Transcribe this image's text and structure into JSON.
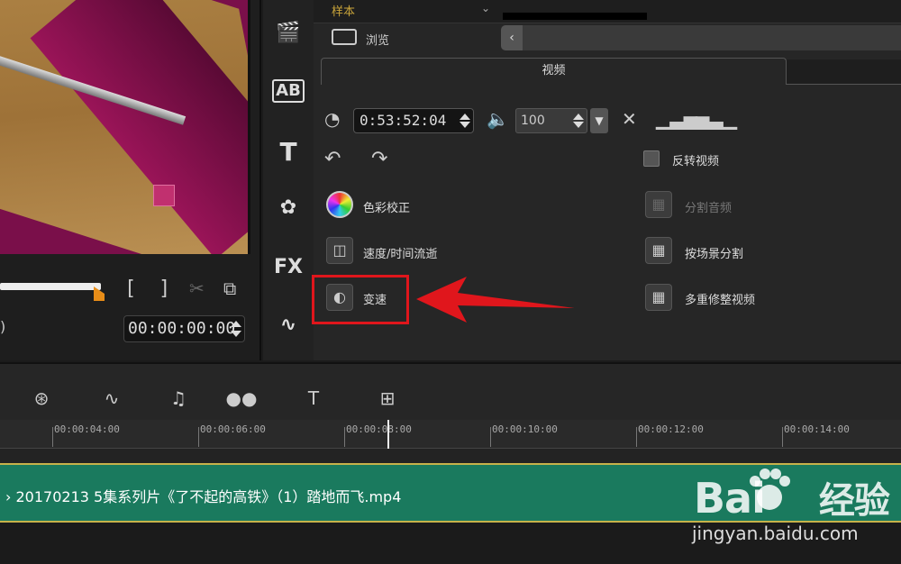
{
  "preview": {
    "timecode": "00:00:00:00",
    "mark_in": "[",
    "mark_out": "]"
  },
  "options": {
    "top_tab_partial": "样本",
    "browse_label": "浏览",
    "tab_video": "视频",
    "duration": "0:53:52:04",
    "volume": "100",
    "reverse_video": "反转视频",
    "color_correction": "色彩校正",
    "split_audio": "分割音频",
    "speed_time_lapse": "速度/时间流逝",
    "split_by_scene": "按场景分割",
    "variable_speed": "变速",
    "multi_trim_video": "多重修整视频"
  },
  "timeline": {
    "ticks": [
      "00:00:04:00",
      "00:00:06:00",
      "00:00:08:00",
      "00:00:10:00",
      "00:00:12:00",
      "00:00:14:00"
    ],
    "clip_name": "› 20170213 5集系列片《了不起的高铁》（1）踏地而飞.mp4"
  },
  "watermark": {
    "brand": "Bai",
    "brand_suffix": "经验",
    "url": "jingyan.baidu.com"
  },
  "colors": {
    "highlight": "#e0161c",
    "clip": "#1a7a5e",
    "scrub_handle": "#e88d18"
  }
}
